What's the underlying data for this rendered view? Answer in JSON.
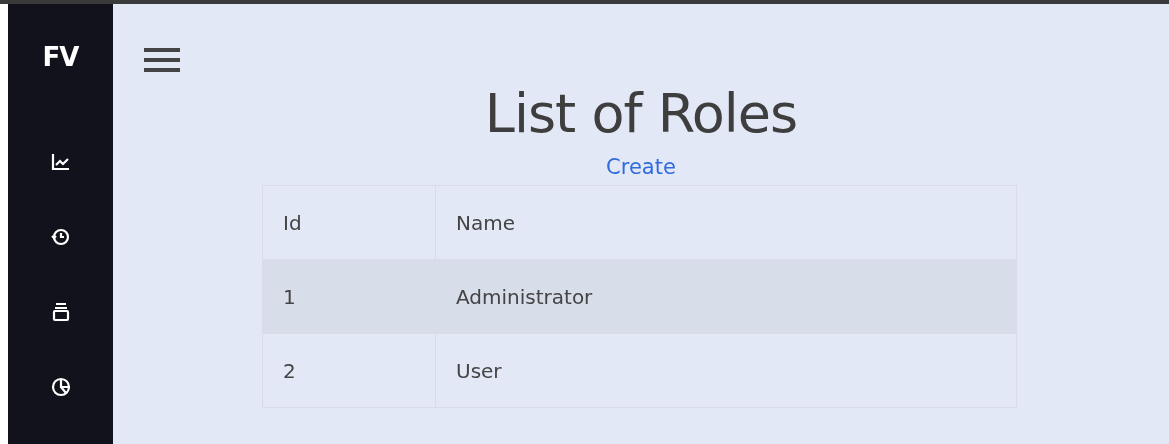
{
  "sidebar": {
    "logo": "FV"
  },
  "page": {
    "title": "List of Roles",
    "create_link": "Create"
  },
  "table": {
    "columns": [
      "Id",
      "Name"
    ],
    "rows": [
      {
        "id": "1",
        "name": "Administrator"
      },
      {
        "id": "2",
        "name": "User"
      }
    ]
  }
}
